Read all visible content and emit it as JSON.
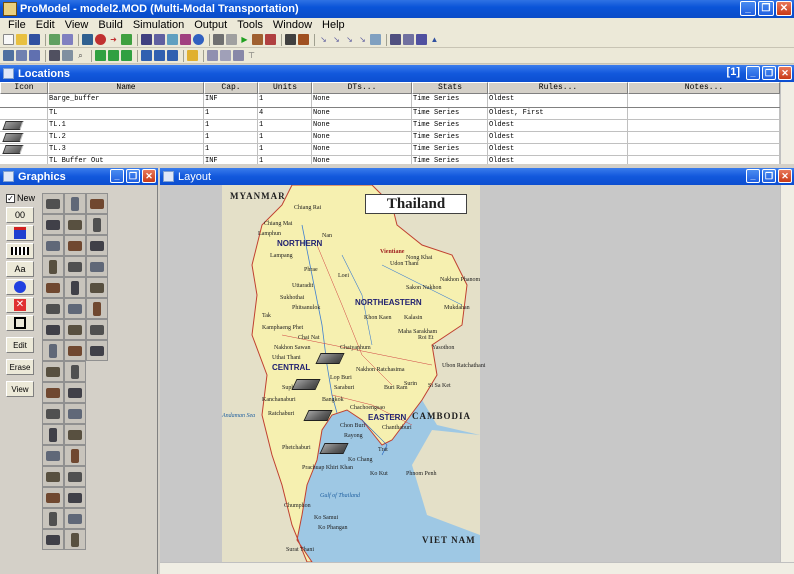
{
  "app": {
    "title": "ProModel - model2.MOD (Multi-Modal Transportation)",
    "accent_color": "#0a54d8"
  },
  "menu": [
    "File",
    "Edit",
    "View",
    "Build",
    "Simulation",
    "Output",
    "Tools",
    "Window",
    "Help"
  ],
  "locations": {
    "title": "Locations",
    "count_indicator": "[1]",
    "columns": [
      "Icon",
      "Name",
      "Cap.",
      "Units",
      "DTs...",
      "Stats",
      "Rules...",
      "Notes..."
    ],
    "rows": [
      {
        "name": "Barge_buffer",
        "cap": "INF",
        "units": "1",
        "dts": "None",
        "stats": "Time Series",
        "rules": "Oldest",
        "notes": ""
      },
      {
        "name": "TL",
        "cap": "1",
        "units": "4",
        "dts": "None",
        "stats": "Time Series",
        "rules": "Oldest, First",
        "notes": ""
      },
      {
        "name": "TL.1",
        "cap": "1",
        "units": "1",
        "dts": "None",
        "stats": "Time Series",
        "rules": "Oldest",
        "notes": ""
      },
      {
        "name": "TL.2",
        "cap": "1",
        "units": "1",
        "dts": "None",
        "stats": "Time Series",
        "rules": "Oldest",
        "notes": ""
      },
      {
        "name": "TL.3",
        "cap": "1",
        "units": "1",
        "dts": "None",
        "stats": "Time Series",
        "rules": "Oldest",
        "notes": ""
      },
      {
        "name": "TL Buffer Out",
        "cap": "INF",
        "units": "1",
        "dts": "None",
        "stats": "Time Series",
        "rules": "Oldest",
        "notes": ""
      }
    ]
  },
  "graphics": {
    "title": "Graphics",
    "new_label": "New",
    "tools": [
      "00",
      "",
      "",
      "Aa",
      "",
      "",
      ""
    ],
    "buttons": [
      "Edit",
      "Erase",
      "View"
    ]
  },
  "layout": {
    "title": "Layout",
    "map_title": "Thailand",
    "countries": [
      "MYANMAR",
      "CAMBODIA",
      "VIET NAM"
    ],
    "regions": [
      "NORTHERN",
      "NORTHEASTERN",
      "CENTRAL",
      "EASTERN"
    ],
    "seas": [
      "Andaman Sea",
      "Gulf of Thailand"
    ],
    "cities": [
      "Chiang Rai",
      "Chiang Mai",
      "Lamphun",
      "Lampang",
      "Nan",
      "Phrae",
      "Uttaradit",
      "Sukhothai",
      "Phitsanulok",
      "Tak",
      "Kamphaeng Phet",
      "Nakhon Sawan",
      "Uthai Thani",
      "Chai Nat",
      "Lop Buri",
      "Saraburi",
      "Suphan Buri",
      "Kanchanaburi",
      "Ratchaburi",
      "Bangkok",
      "Chachoengsao",
      "Chon Buri",
      "Rayong",
      "Chanthaburi",
      "Trat",
      "Ko Chang",
      "Ko Kut",
      "Phetchaburi",
      "Prachuap Khiri Khan",
      "Chumphon",
      "Ko Phangan",
      "Ko Samui",
      "Surat Thani",
      "Vientiane",
      "Udon Thani",
      "Nong Khai",
      "Loei",
      "Khon Kaen",
      "Nakhon Phanom",
      "Sakon Nakhon",
      "Mukdahan",
      "Kalasin",
      "Maha Sarakham",
      "Roi Et",
      "Yasothon",
      "Ubon Ratchathani",
      "Chaiyaphum",
      "Nakhon Ratchasima",
      "Buri Ram",
      "Surin",
      "Si Sa Ket",
      "Phnom Penh"
    ]
  }
}
